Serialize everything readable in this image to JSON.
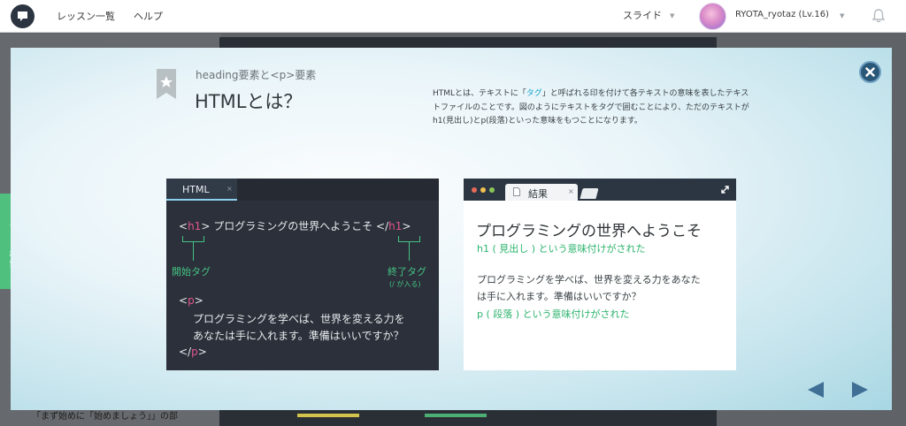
{
  "header": {
    "logo_icon": "progate-logo-icon",
    "nav_links": [
      "レッスン一覧",
      "ヘルプ"
    ],
    "mode_select": "スライド",
    "user_name": "RYOTA_ryotaz (Lv.16)",
    "bell_icon": "bell-icon"
  },
  "background": {
    "bottom_text": "「まず始めに「始めましょう」」の部"
  },
  "side_tab": {
    "label": "スライドを検索"
  },
  "slide": {
    "section_title": "heading要素と<p>要素",
    "title": "HTMLとは？",
    "description": {
      "part1": "HTMLとは、テキストに「",
      "tag_word": "タグ",
      "part2": "」と呼ばれる印を付けて各テキストの意味を表したテキストファイルのことです。図のようにテキストをタグで囲むことにより、ただのテキストがh1(見出し)とp(段落)といった意味をもつことになります。"
    },
    "editor": {
      "tab_label": "HTML",
      "tab_close": "×",
      "h1_open_lt": "<",
      "h1_open_name": "h1",
      "h1_open_gt": ">",
      "h1_text": " プログラミングの世界へようこそ ",
      "h1_close_lt": "</",
      "h1_close_name": "h1",
      "h1_close_gt": ">",
      "open_tag_label": "開始タグ",
      "close_tag_label": "終了タグ",
      "close_tag_note": "(/ が入る)",
      "p_open_lt": "<",
      "p_open_name": "p",
      "p_open_gt": ">",
      "p_text_line1": "プログラミングを学べば、世界を変える力を",
      "p_text_line2": "あなたは手に入れます。準備はいいですか？",
      "p_close_lt": "</",
      "p_close_name": "p",
      "p_close_gt": ">"
    },
    "result": {
      "tab_label": "結果",
      "tab_close": "×",
      "heading": "プログラミングの世界へようこそ",
      "h1_note": "h1 ( 見出し ) という意味付けがされた",
      "para_line1": "プログラミングを学べば、世界を変える力をあなた",
      "para_line2": "は手に入れます。準備はいいですか？",
      "p_note": "p ( 段落 ) という意味付けがされた"
    },
    "colors": {
      "tag": "#e4558e",
      "annotation": "#46c283",
      "accent": "#19a6d3"
    }
  }
}
